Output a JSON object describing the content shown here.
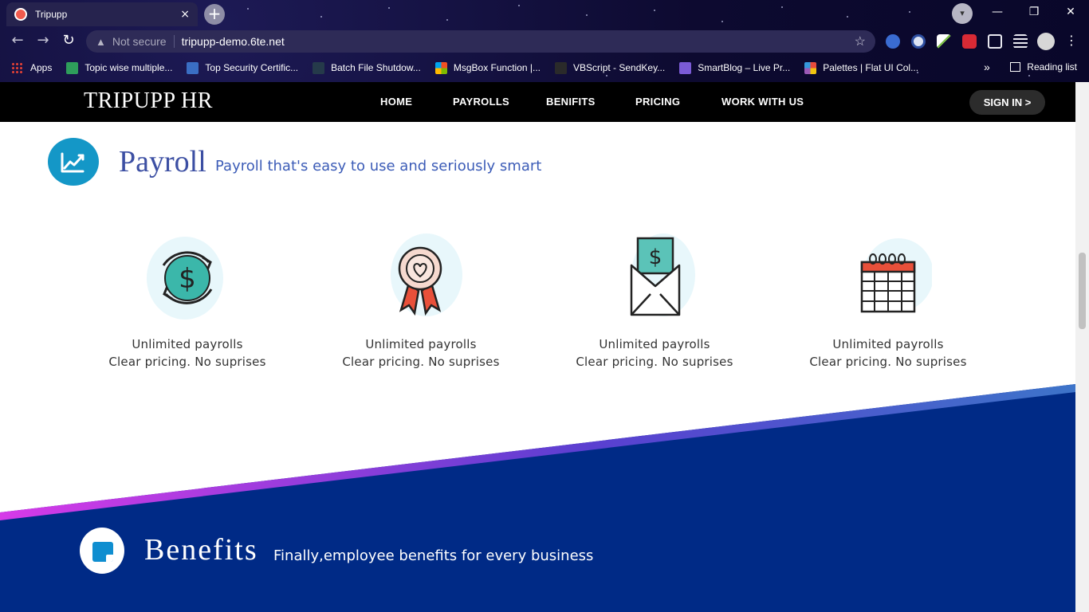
{
  "browser": {
    "tab_title": "Tripupp",
    "tab_close": "×",
    "new_tab": "+",
    "window_controls": {
      "minimize": "—",
      "restore": "❐",
      "close": "✕"
    },
    "profile_dropdown": "▾",
    "back": "←",
    "forward": "→",
    "reload": "↻",
    "security_label": "Not secure",
    "security_icon": "▲",
    "url": "tripupp-demo.6te.net",
    "star_icon": "☆",
    "bookmarks": [
      {
        "label": "Apps",
        "color": "#e94235"
      },
      {
        "label": "Topic wise multiple...",
        "color": "#2e9e5b"
      },
      {
        "label": "Top Security Certific...",
        "color": "#3a6ec3"
      },
      {
        "label": "Batch File Shutdow...",
        "color": "#253a4a"
      },
      {
        "label": "MsgBox Function |...",
        "color": "#f25022"
      },
      {
        "label": "VBScript - SendKey...",
        "color": "#2a2a2a"
      },
      {
        "label": "SmartBlog – Live Pr...",
        "color": "#7b5bd6"
      },
      {
        "label": "Palettes | Flat UI Col...",
        "color": "#e74c3c"
      }
    ],
    "bookmarks_overflow": "»",
    "reading_list": "Reading list"
  },
  "site": {
    "brand": "TRIPUPP HR",
    "nav": [
      "HOME",
      "PAYROLLS",
      "BENIFITS",
      "PRICING",
      "WORK WITH US"
    ],
    "signin": "SIGN IN >",
    "payroll_section": {
      "title": "Payroll",
      "subtitle": "Payroll that's easy to use and seriously smart",
      "features": [
        {
          "icon": "refresh-dollar-icon",
          "line1": "Unlimited payrolls",
          "line2": "Clear pricing. No suprises"
        },
        {
          "icon": "award-ribbon-icon",
          "line1": "Unlimited payrolls",
          "line2": "Clear pricing. No suprises"
        },
        {
          "icon": "envelope-dollar-icon",
          "line1": "Unlimited payrolls",
          "line2": "Clear pricing. No suprises"
        },
        {
          "icon": "calendar-icon",
          "line1": "Unlimited payrolls",
          "line2": "Clear pricing. No suprises"
        }
      ]
    },
    "benefits_section": {
      "title": "Benefits",
      "subtitle": "Finally,employee benefits for every business"
    }
  },
  "colors": {
    "navy": "#002a86",
    "accent_blue": "#1497c7",
    "heading_blue": "#3c4fa3",
    "teal": "#3bb7aa"
  }
}
